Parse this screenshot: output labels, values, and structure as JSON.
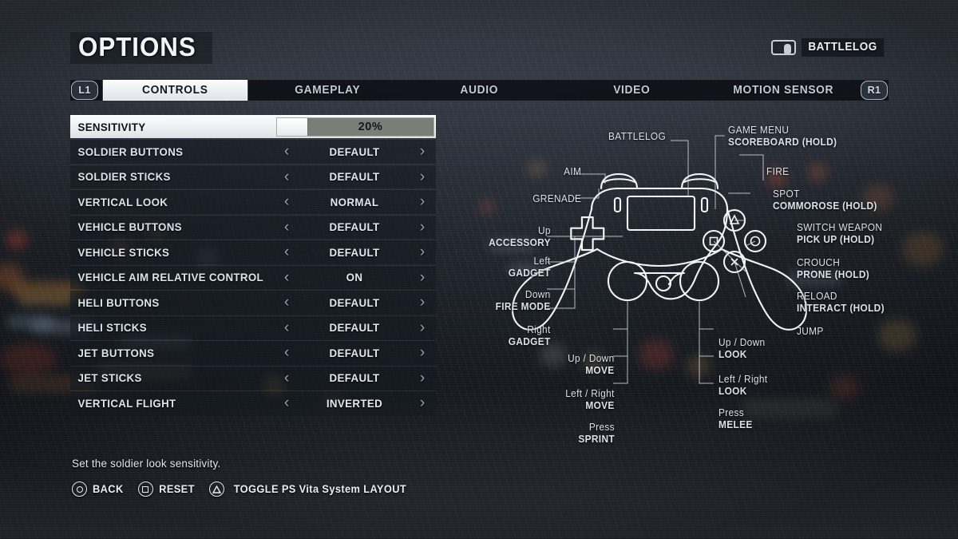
{
  "header": {
    "title": "OPTIONS",
    "battlelog_label": "BATTLELOG",
    "touchpad_icon": "touchpad-icon"
  },
  "tabs": {
    "left_bumper": "L1",
    "right_bumper": "R1",
    "items": [
      {
        "label": "CONTROLS",
        "active": true
      },
      {
        "label": "GAMEPLAY",
        "active": false
      },
      {
        "label": "AUDIO",
        "active": false
      },
      {
        "label": "VIDEO",
        "active": false
      },
      {
        "label": "MOTION SENSOR",
        "active": false
      }
    ]
  },
  "settings": {
    "slider_row": {
      "label": "SENSITIVITY",
      "value_text": "20%",
      "percent": 20
    },
    "rows": [
      {
        "label": "SOLDIER BUTTONS",
        "value": "DEFAULT"
      },
      {
        "label": "SOLDIER STICKS",
        "value": "DEFAULT"
      },
      {
        "label": "VERTICAL LOOK",
        "value": "NORMAL"
      },
      {
        "label": "VEHICLE BUTTONS",
        "value": "DEFAULT"
      },
      {
        "label": "VEHICLE STICKS",
        "value": "DEFAULT"
      },
      {
        "label": "VEHICLE AIM RELATIVE CONTROL",
        "value": "ON"
      },
      {
        "label": "HELI BUTTONS",
        "value": "DEFAULT"
      },
      {
        "label": "HELI STICKS",
        "value": "DEFAULT"
      },
      {
        "label": "JET BUTTONS",
        "value": "DEFAULT"
      },
      {
        "label": "JET STICKS",
        "value": "DEFAULT"
      },
      {
        "label": "VERTICAL FLIGHT",
        "value": "INVERTED"
      }
    ],
    "arrow_left": "‹",
    "arrow_right": "›"
  },
  "footer": {
    "description": "Set the soldier look sensitivity.",
    "prompts": [
      {
        "glyph": "circle",
        "label": "BACK"
      },
      {
        "glyph": "square",
        "label": "RESET"
      },
      {
        "glyph": "triangle",
        "label": "TOGGLE PS Vita System LAYOUT"
      }
    ]
  },
  "diagram": {
    "labels_left": [
      {
        "id": "aim",
        "line1": "AIM",
        "line2": ""
      },
      {
        "id": "grenade",
        "line1": "GRENADE",
        "line2": ""
      },
      {
        "id": "dpad-up",
        "line1": "Up",
        "line2": "ACCESSORY"
      },
      {
        "id": "dpad-left",
        "line1": "Left",
        "line2": "GADGET"
      },
      {
        "id": "dpad-down",
        "line1": "Down",
        "line2": "FIRE MODE"
      },
      {
        "id": "dpad-right",
        "line1": "Right",
        "line2": "GADGET"
      },
      {
        "id": "left-stick-updown",
        "line1": "Up / Down",
        "line2": "MOVE"
      },
      {
        "id": "left-stick-leftright",
        "line1": "Left / Right",
        "line2": "MOVE"
      },
      {
        "id": "left-stick-press",
        "line1": "Press",
        "line2": "SPRINT"
      }
    ],
    "labels_top": [
      {
        "id": "battlelog-touchpad",
        "line1": "BATTLELOG",
        "line2": ""
      }
    ],
    "labels_right": [
      {
        "id": "options-button",
        "line1": "GAME MENU",
        "line2": "SCOREBOARD (HOLD)"
      },
      {
        "id": "r2-fire",
        "line1": "FIRE",
        "line2": ""
      },
      {
        "id": "r1-spot",
        "line1": "SPOT",
        "line2": "COMMOROSE (HOLD)"
      },
      {
        "id": "triangle-switch",
        "line1": "SWITCH WEAPON",
        "line2": "PICK UP (HOLD)"
      },
      {
        "id": "circle-crouch",
        "line1": "CROUCH",
        "line2": "PRONE (HOLD)"
      },
      {
        "id": "square-reload",
        "line1": "RELOAD",
        "line2": "INTERACT (HOLD)"
      },
      {
        "id": "cross-jump",
        "line1": "JUMP",
        "line2": ""
      },
      {
        "id": "right-stick-updown",
        "line1": "Up / Down",
        "line2": "LOOK"
      },
      {
        "id": "right-stick-leftright",
        "line1": "Left / Right",
        "line2": "LOOK"
      },
      {
        "id": "right-stick-press",
        "line1": "Press",
        "line2": "MELEE"
      }
    ],
    "face_buttons": [
      "triangle",
      "circle",
      "square",
      "cross"
    ]
  },
  "colors": {
    "accent_white": "#ffffff",
    "panel_dark": "#141920",
    "text_light": "#dde3ea",
    "slider_track": "#7b7d79",
    "bg_top": "#434b58",
    "bg_mid": "#1b2027"
  }
}
